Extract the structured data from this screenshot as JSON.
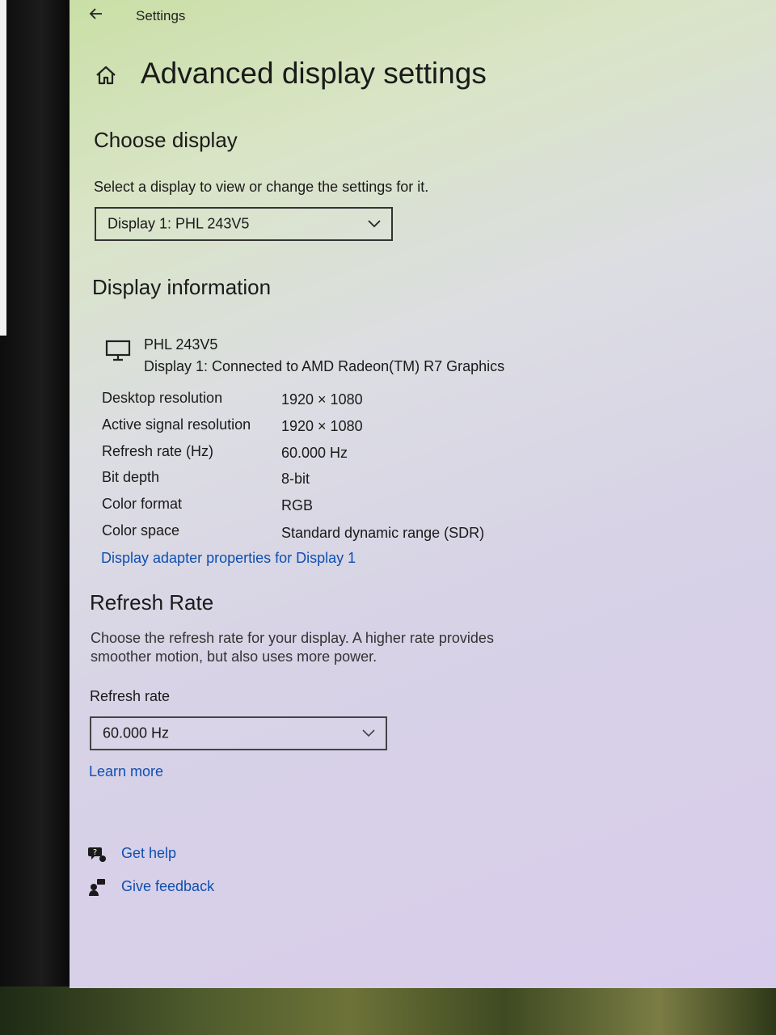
{
  "window": {
    "title": "Settings"
  },
  "page": {
    "title": "Advanced display settings"
  },
  "choose_display": {
    "heading": "Choose display",
    "description": "Select a display to view or change the settings for it.",
    "selected_display": "Display 1: PHL 243V5"
  },
  "display_information": {
    "heading": "Display information",
    "monitor_name": "PHL 243V5",
    "connection": "Display 1: Connected to AMD Radeon(TM) R7 Graphics",
    "rows": [
      {
        "label": "Desktop resolution",
        "value": "1920 × 1080"
      },
      {
        "label": "Active signal resolution",
        "value": "1920 × 1080"
      },
      {
        "label": "Refresh rate (Hz)",
        "value": "60.000 Hz"
      },
      {
        "label": "Bit depth",
        "value": "8-bit"
      },
      {
        "label": "Color format",
        "value": "RGB"
      },
      {
        "label": "Color space",
        "value": "Standard dynamic range (SDR)"
      }
    ],
    "adapter_link": "Display adapter properties for Display 1"
  },
  "refresh_rate": {
    "heading": "Refresh Rate",
    "description": "Choose the refresh rate for your display. A higher rate provides smoother motion, but also uses more power.",
    "label": "Refresh rate",
    "selected": "60.000 Hz",
    "learn_more": "Learn more"
  },
  "footer": {
    "get_help": "Get help",
    "give_feedback": "Give feedback"
  },
  "colors": {
    "link": "#0f4fb0",
    "text": "#1a1a1a"
  },
  "icons": [
    "back-arrow-icon",
    "home-icon",
    "chevron-down-icon",
    "monitor-icon",
    "get-help-icon",
    "feedback-icon"
  ]
}
